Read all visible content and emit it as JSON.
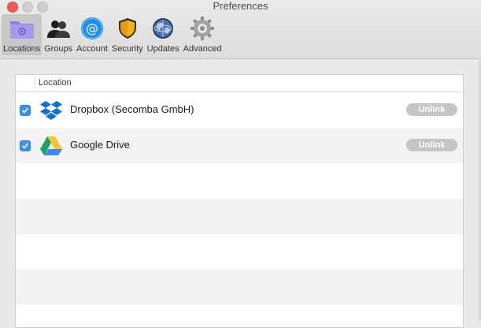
{
  "window": {
    "title": "Preferences"
  },
  "toolbar": {
    "items": [
      {
        "label": "Locations",
        "icon": "folder-icon",
        "active": true
      },
      {
        "label": "Groups",
        "icon": "people-icon",
        "active": false
      },
      {
        "label": "Account",
        "icon": "at-sign-icon",
        "active": false
      },
      {
        "label": "Security",
        "icon": "shield-icon",
        "active": false
      },
      {
        "label": "Updates",
        "icon": "globe-icon",
        "active": false
      },
      {
        "label": "Advanced",
        "icon": "gear-icon",
        "active": false
      }
    ]
  },
  "table": {
    "column_header": "Location",
    "rows": [
      {
        "name": "Dropbox (Secomba GmbH)",
        "checked": true,
        "icon": "dropbox-icon",
        "action": "Unlink"
      },
      {
        "name": "Google Drive",
        "checked": true,
        "icon": "google-drive-icon",
        "action": "Unlink"
      }
    ]
  },
  "colors": {
    "checkbox": "#3b93f0",
    "unlink_button": "#c5c5c5",
    "dropbox": "#0f6fd6"
  }
}
